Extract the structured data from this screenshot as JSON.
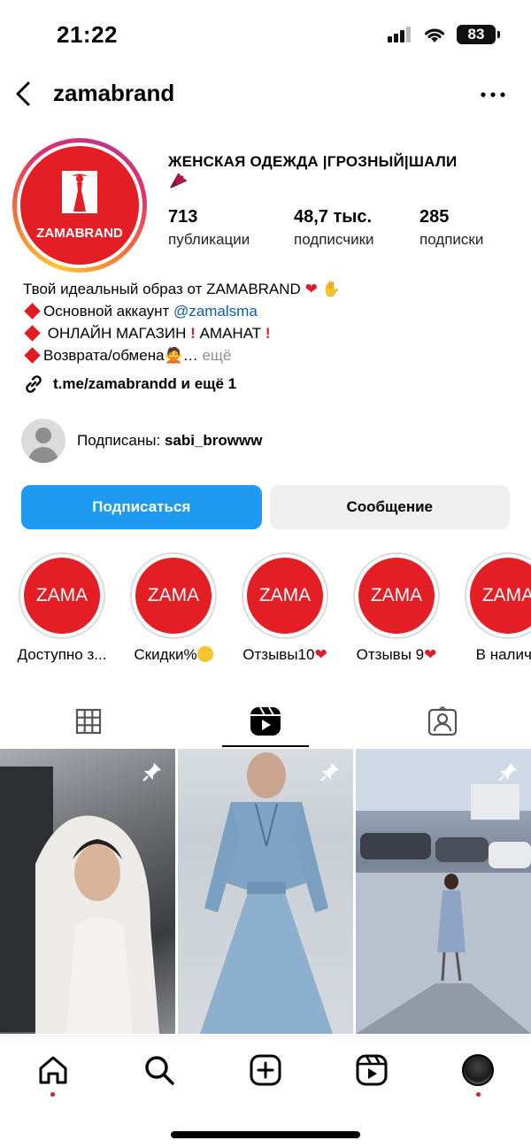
{
  "status_bar": {
    "time": "21:22",
    "battery": "83"
  },
  "header": {
    "username": "zamabrand"
  },
  "profile": {
    "avatar_text": "ZAMABRAND",
    "name": "ЖЕНСКАЯ ОДЕЖДА |ГРОЗНЫЙ|ШАЛИ",
    "stats": [
      {
        "value": "713",
        "label": "публикации"
      },
      {
        "value": "48,7 тыс.",
        "label": "подписчики"
      },
      {
        "value": "285",
        "label": "подписки"
      }
    ]
  },
  "bio": {
    "line1": "Твой идеальный образ от ZAMABRAND",
    "line2_prefix": "Основной аккаунт",
    "line2_mention": "@zamalsma",
    "line3": "ОНЛАЙН МАГАЗИН",
    "line3_b": "АМАНАТ",
    "line4": "Возврата/обмена",
    "line4_ellipsis": "…",
    "more": "ещё",
    "link": "t.me/zamabrandd и ещё 1"
  },
  "followed_by": {
    "prefix": "Подписаны:",
    "user": "sabi_browww"
  },
  "actions": {
    "follow": "Подписаться",
    "message": "Сообщение"
  },
  "highlights": [
    {
      "cover": "ZAMA",
      "label": "Доступно з..."
    },
    {
      "cover": "ZAMA",
      "label": "Скидки%"
    },
    {
      "cover": "ZAMA",
      "label": "Отзывы10"
    },
    {
      "cover": "ZAMA",
      "label": "Отзывы 9"
    },
    {
      "cover": "ZAMA",
      "label": "В наличи"
    }
  ],
  "tabs": [
    {
      "icon": "grid-icon",
      "active": false
    },
    {
      "icon": "reels-icon",
      "active": true
    },
    {
      "icon": "tagged-icon",
      "active": false
    }
  ],
  "posts": [
    {
      "pinned": true,
      "subject": "bride-in-car"
    },
    {
      "pinned": true,
      "subject": "blue-floral-dress"
    },
    {
      "pinned": true,
      "subject": "woman-walking-street"
    }
  ],
  "bottom_nav": [
    "home-icon",
    "search-icon",
    "create-icon",
    "reels-icon",
    "profile-avatar"
  ],
  "colors": {
    "accent": "#1e9bf0",
    "brand": "#e31e24",
    "mention": "#0b5cad"
  }
}
